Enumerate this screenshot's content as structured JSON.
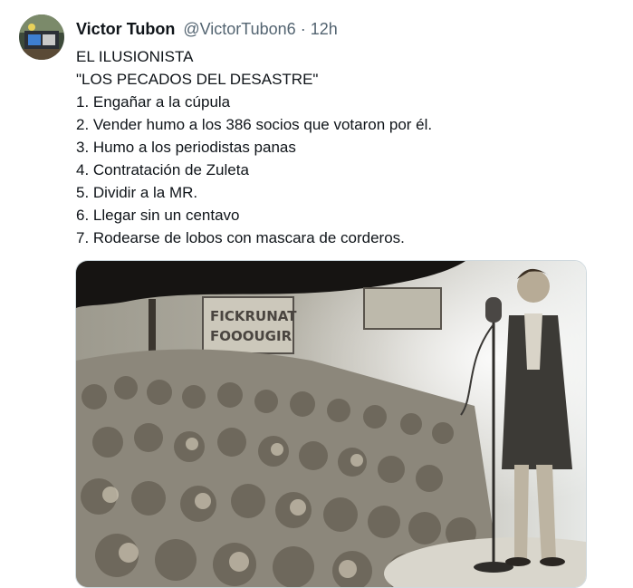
{
  "author": {
    "display_name": "Victor Tubon",
    "handle": "@VictorTubon6",
    "separator": "·",
    "time_ago": "12h"
  },
  "tweet": {
    "lines": [
      "EL ILUSIONISTA",
      "\"LOS PECADOS DEL DESASTRE\"",
      "1. Engañar a la cúpula",
      "2. Vender humo a los 386 socios que votaron por él.",
      "3. Humo a los periodistas panas",
      "4. Contratación de Zuleta",
      "5. Dividir a la MR.",
      "6. Llegar sin un centavo",
      "7. Rodearse de lobos con mascara de corderos."
    ]
  },
  "media": {
    "banner_line1": "FICKRUNAT",
    "banner_line2": "FOOOUGIR",
    "accent": "#8a8070"
  }
}
